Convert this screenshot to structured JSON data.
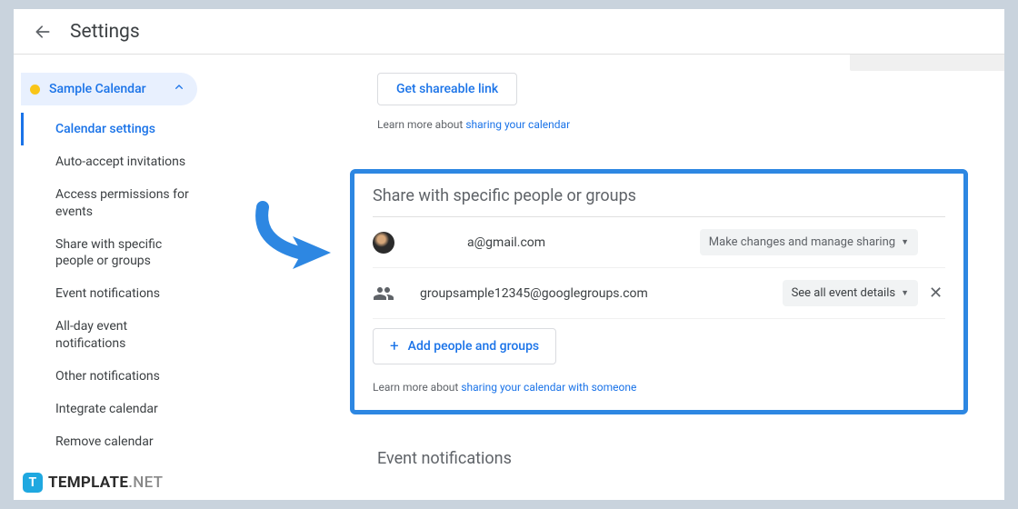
{
  "header": {
    "title": "Settings"
  },
  "sidebar": {
    "calendar_name": "Sample Calendar",
    "items": [
      "Calendar settings",
      "Auto-accept invitations",
      "Access permissions for events",
      "Share with specific people or groups",
      "Event notifications",
      "All-day event notifications",
      "Other notifications",
      "Integrate calendar",
      "Remove calendar"
    ]
  },
  "main": {
    "shareable_link_btn": "Get shareable link",
    "learn_prefix": "Learn more about ",
    "learn_link": "sharing your calendar",
    "section_title": "Share with specific people or groups",
    "rows": [
      {
        "email": "a@gmail.com",
        "permission": "Make changes and manage sharing"
      },
      {
        "email": "groupsample12345@googlegroups.com",
        "permission": "See all event details"
      }
    ],
    "add_btn": "Add people and groups",
    "learn_inside_prefix": "Learn more about ",
    "learn_inside_link": "sharing your calendar with someone",
    "next_section": "Event notifications"
  },
  "watermark": {
    "brand": "TEMPLATE",
    "suffix": ".NET"
  }
}
